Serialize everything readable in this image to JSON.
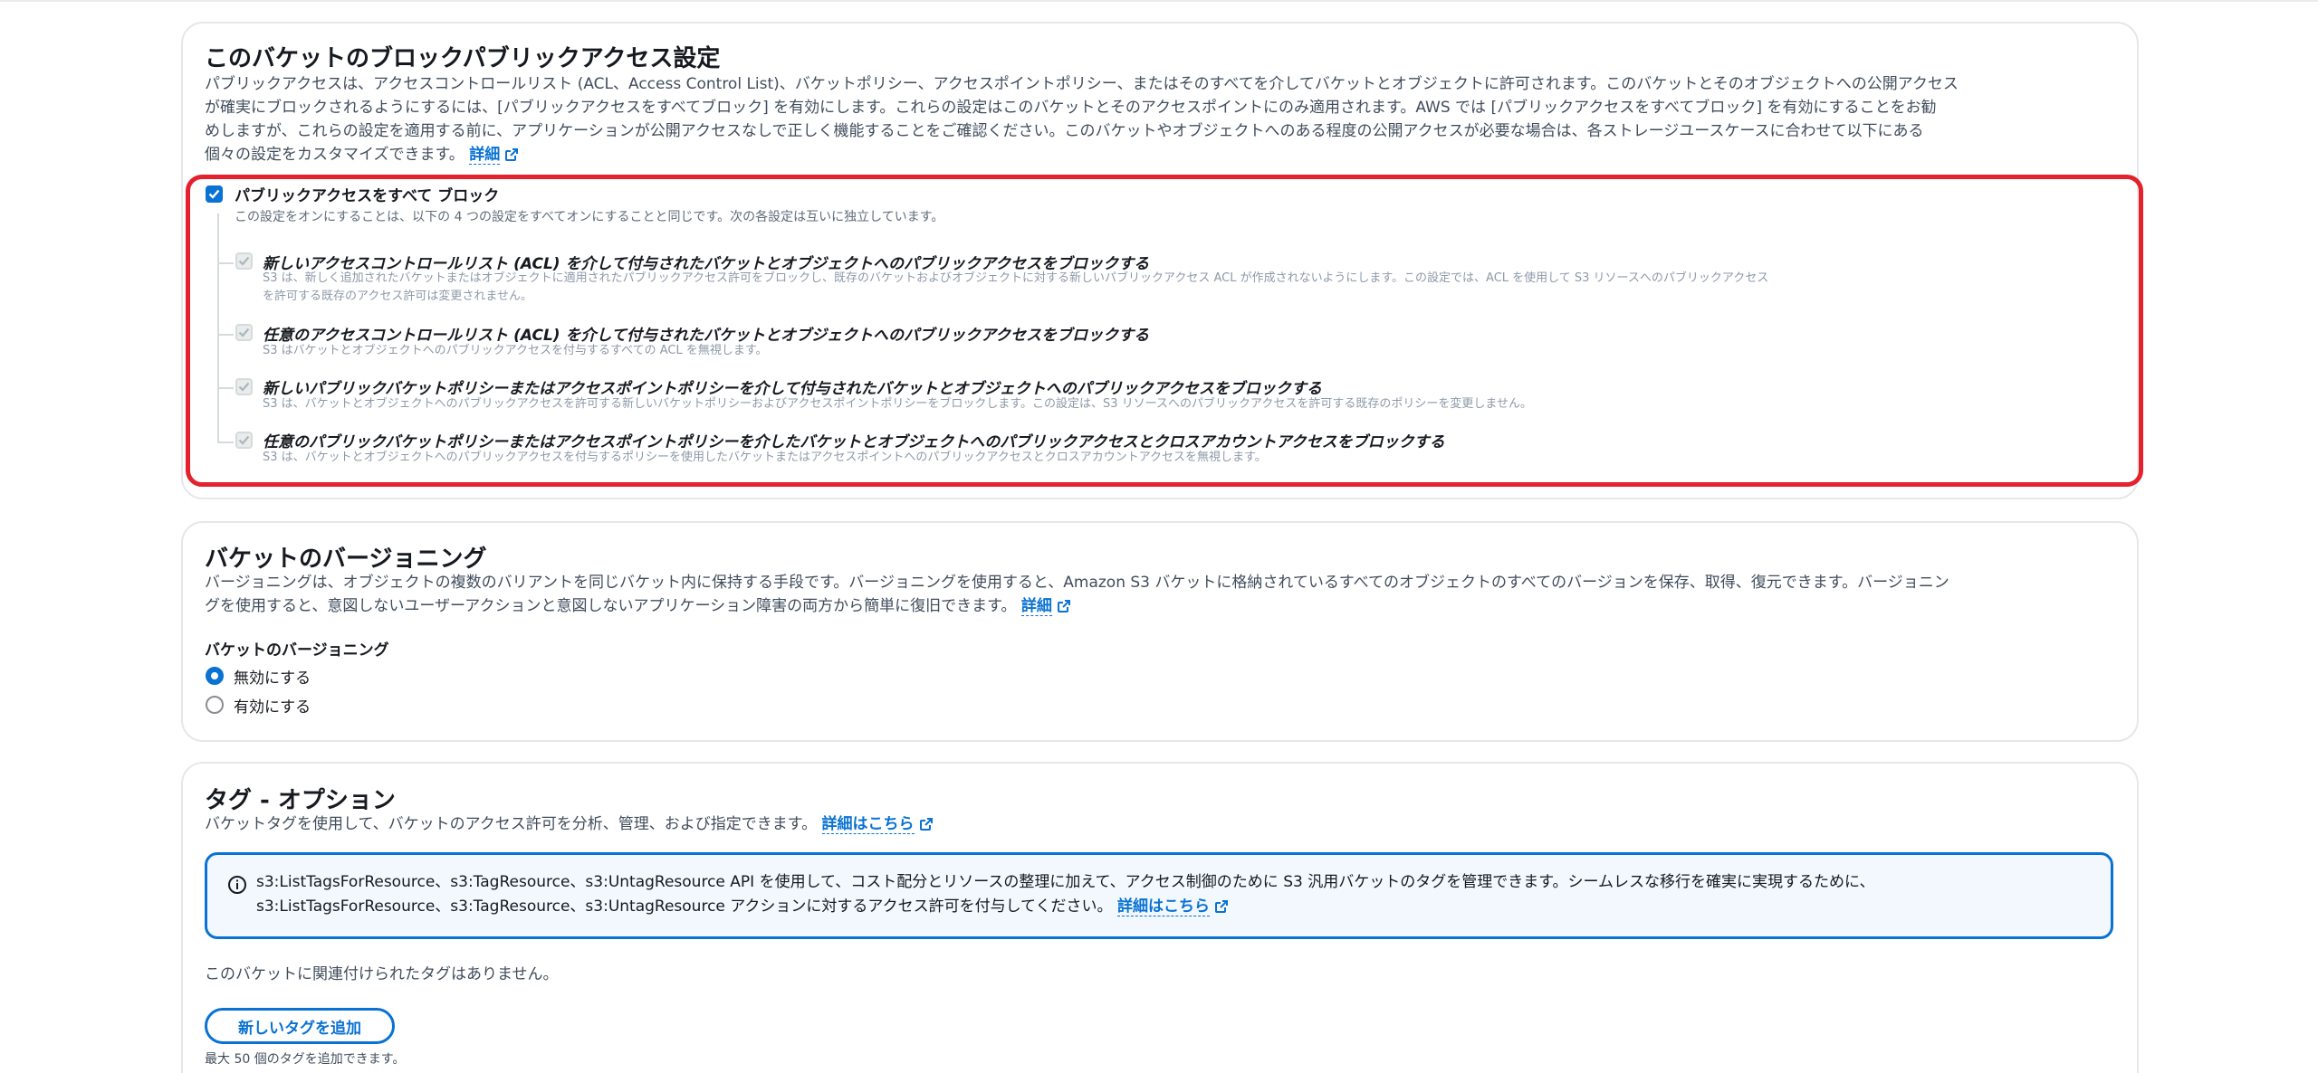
{
  "block_public_access": {
    "title": "このバケットのブロックパブリックアクセス設定",
    "desc_lines": [
      "パブリックアクセスは、アクセスコントロールリスト (ACL、Access Control List)、バケットポリシー、アクセスポイントポリシー、またはそのすべてを介してバケットとオブジェクトに許可されます。このバケットとそのオブジェクトへの公開アクセス",
      "が確実にブロックされるようにするには、[パブリックアクセスをすべてブロック] を有効にします。これらの設定はこのバケットとそのアクセスポイントにのみ適用されます。AWS では [パブリックアクセスをすべてブロック] を有効にすることをお勧",
      "めしますが、これらの設定を適用する前に、アプリケーションが公開アクセスなしで正しく機能することをご確認ください。このバケットやオブジェクトへのある程度の公開アクセスが必要な場合は、各ストレージユースケースに合わせて以下にある",
      "個々の設定をカスタマイズできます。"
    ],
    "learn_more": "詳細",
    "block_all": {
      "label": "パブリックアクセスをすべて ブロック",
      "desc": "この設定をオンにすることは、以下の 4 つの設定をすべてオンにすることと同じです。次の各設定は互いに独立しています。",
      "checked": true
    },
    "options": [
      {
        "label": "新しいアクセスコントロールリスト (ACL) を介して付与されたバケットとオブジェクトへのパブリックアクセスをブロックする",
        "desc_lines": [
          "S3 は、新しく追加されたバケットまたはオブジェクトに適用されたパブリックアクセス許可をブロックし、既存のバケットおよびオブジェクトに対する新しいパブリックアクセス ACL が作成されないようにします。この設定では、ACL を使用して S3 リソースへのパブリックアクセス",
          "を許可する既存のアクセス許可は変更されません。"
        ]
      },
      {
        "label": "任意のアクセスコントロールリスト (ACL) を介して付与されたバケットとオブジェクトへのパブリックアクセスをブロックする",
        "desc_lines": [
          "S3 はバケットとオブジェクトへのパブリックアクセスを付与するすべての ACL を無視します。"
        ]
      },
      {
        "label": "新しいパブリックバケットポリシーまたはアクセスポイントポリシーを介して付与されたバケットとオブジェクトへのパブリックアクセスをブロックする",
        "desc_lines": [
          "S3 は、バケットとオブジェクトへのパブリックアクセスを許可する新しいバケットポリシーおよびアクセスポイントポリシーをブロックします。この設定は、S3 リソースへのパブリックアクセスを許可する既存のポリシーを変更しません。"
        ]
      },
      {
        "label": "任意のパブリックバケットポリシーまたはアクセスポイントポリシーを介したバケットとオブジェクトへのパブリックアクセスとクロスアカウントアクセスをブロックする",
        "desc_lines": [
          "S3 は、バケットとオブジェクトへのパブリックアクセスを付与するポリシーを使用したバケットまたはアクセスポイントへのパブリックアクセスとクロスアカウントアクセスを無視します。"
        ]
      }
    ]
  },
  "versioning": {
    "title": "バケットのバージョニング",
    "desc_lines": [
      "バージョニングは、オブジェクトの複数のバリアントを同じバケット内に保持する手段です。バージョニングを使用すると、Amazon S3 バケットに格納されているすべてのオブジェクトのすべてのバージョンを保存、取得、復元できます。バージョニン",
      "グを使用すると、意図しないユーザーアクションと意図しないアプリケーション障害の両方から簡単に復旧できます。"
    ],
    "learn_more": "詳細",
    "field_label": "バケットのバージョニング",
    "options": [
      "無効にする",
      "有効にする"
    ],
    "selected": "無効にする"
  },
  "tags": {
    "title": "タグ - オプション",
    "desc": "バケットタグを使用して、バケットのアクセス許可を分析、管理、および指定できます。",
    "learn_more": "詳細はこちら",
    "info_lines": [
      "s3:ListTagsForResource、s3:TagResource、s3:UntagResource API を使用して、コスト配分とリソースの整理に加えて、アクセス制御のために S3 汎用バケットのタグを管理できます。シームレスな移行を確実に実現するために、",
      "s3:ListTagsForResource、s3:TagResource、s3:UntagResource アクションに対するアクセス許可を付与してください。"
    ],
    "info_learn_more": "詳細はこちら",
    "empty_text": "このバケットに関連付けられたタグはありません。",
    "add_button": "新しいタグを追加",
    "limit_text": "最大 50 個のタグを追加できます。"
  },
  "colors": {
    "accent": "#0972d3",
    "highlight": "#e3222e",
    "info_bg": "#f2f8fd"
  }
}
